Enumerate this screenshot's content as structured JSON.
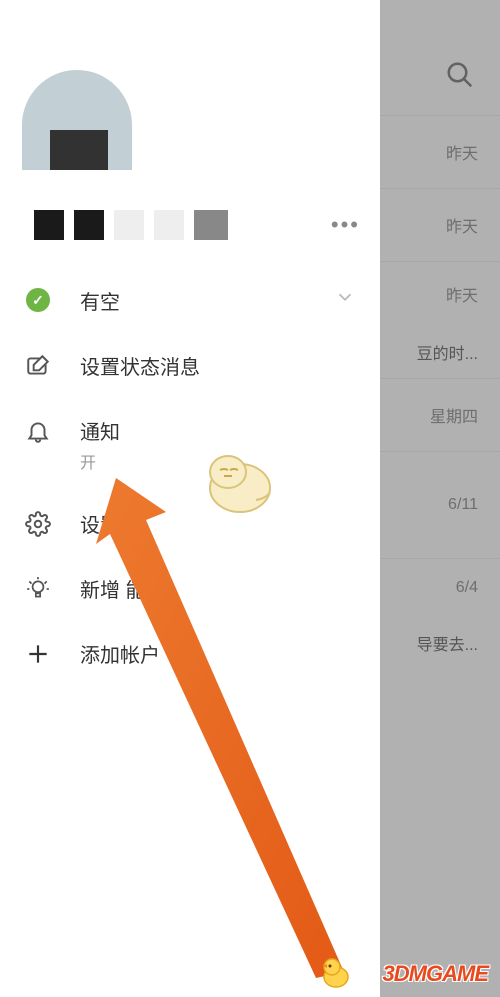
{
  "background": {
    "rows": [
      {
        "date": "昨天",
        "sub": null
      },
      {
        "date": "昨天",
        "sub": null
      },
      {
        "date": "昨天",
        "sub": "豆的时..."
      },
      {
        "date": "星期四",
        "sub": null
      },
      {
        "date": "6/11",
        "sub": null
      },
      {
        "date": "6/4",
        "sub": "导要去..."
      }
    ]
  },
  "drawer": {
    "status": {
      "label": "有空"
    },
    "status_msg": {
      "label": "设置状态消息"
    },
    "notifications": {
      "label": "通知",
      "value": "开"
    },
    "settings": {
      "label": "设置"
    },
    "whatsnew": {
      "label": "新增  能"
    },
    "add_account": {
      "label": "添加帐户"
    }
  },
  "watermark": "3DMGAME"
}
